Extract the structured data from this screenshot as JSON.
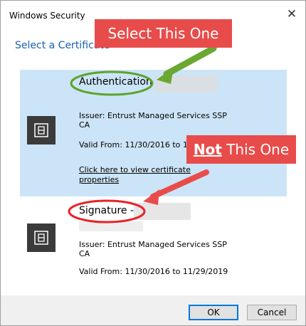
{
  "window": {
    "title": "Windows Security",
    "close_glyph": "✕"
  },
  "dialog": {
    "subtitle": "Select a Certificate"
  },
  "certificates": [
    {
      "name": "Authentication",
      "issuer": "Issuer: Entrust Managed Services SSP CA",
      "valid": "Valid From: 11/30/2016 to 11",
      "link": "Click here to view certificate properties",
      "selected": true
    },
    {
      "name": "Signature -",
      "issuer": "Issuer: Entrust Managed Services SSP CA",
      "valid": "Valid From: 11/30/2016 to 11/29/2019",
      "selected": false
    }
  ],
  "buttons": {
    "ok": "OK",
    "cancel": "Cancel"
  },
  "annotations": {
    "select_label": "Select This One",
    "not_strong": "Not",
    "not_rest": " This One",
    "colors": {
      "callout": "#e84c4a",
      "green_arrow": "#6aa832",
      "green_ellipse": "#5da32a",
      "red_ellipse": "#e8232a"
    }
  },
  "icons": {
    "certificate": "certificate-icon",
    "close": "close-icon"
  }
}
